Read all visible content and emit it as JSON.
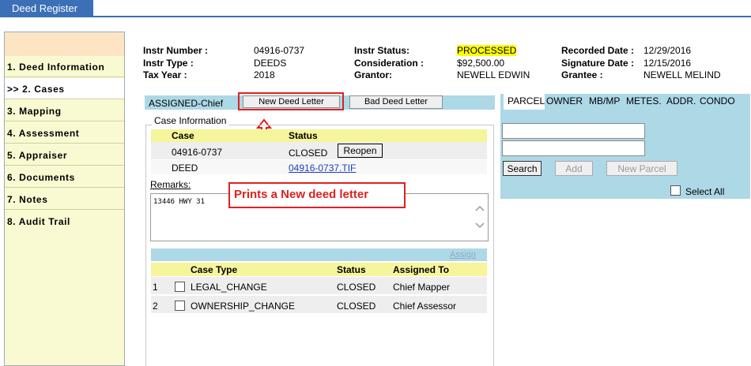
{
  "app": {
    "title": "Deed Register"
  },
  "sidebar": {
    "items": [
      {
        "label": "1. Deed Information"
      },
      {
        "label": ">> 2. Cases"
      },
      {
        "label": "3. Mapping"
      },
      {
        "label": "4. Assessment"
      },
      {
        "label": "5. Appraiser"
      },
      {
        "label": "6. Documents"
      },
      {
        "label": "7. Notes"
      },
      {
        "label": "8. Audit Trail"
      }
    ]
  },
  "header": {
    "instr_number_label": "Instr Number :",
    "instr_number": "04916-0737",
    "instr_type_label": "Instr Type :",
    "instr_type": "DEEDS",
    "tax_year_label": "Tax Year :",
    "tax_year": "2018",
    "instr_status_label": "Instr Status:",
    "instr_status": "PROCESSED",
    "consideration_label": "Consideration :",
    "consideration": "$92,500.00",
    "grantor_label": "Grantor:",
    "grantor": "NEWELL EDWIN",
    "recorded_date_label": "Recorded Date :",
    "recorded_date": "12/29/2016",
    "signature_date_label": "Signature Date :",
    "signature_date": "12/15/2016",
    "grantee_label": "Grantee :",
    "grantee": "NEWELL MELIND"
  },
  "assigned": {
    "label": "ASSIGNED-Chief",
    "new_deed_letter": "New Deed Letter",
    "bad_deed_letter": "Bad Deed Letter"
  },
  "case_info": {
    "legend": "Case Information",
    "headers": {
      "case": "Case",
      "status": "Status"
    },
    "case": "04916-0737",
    "status": "CLOSED",
    "reopen": "Reopen",
    "doc_type": "DEED",
    "doc_link": " 04916-0737.TIF"
  },
  "remarks": {
    "label": "Remarks:",
    "text": "13446 HWY 31"
  },
  "annotation": {
    "text": "Prints a New deed letter"
  },
  "case_types": {
    "assign": "Assign",
    "headers": {
      "case_type": "Case Type",
      "status": "Status",
      "assigned_to": "Assigned To"
    },
    "rows": [
      {
        "num": "1",
        "case_type": "LEGAL_CHANGE",
        "status": "CLOSED",
        "assigned_to": "Chief Mapper"
      },
      {
        "num": "2",
        "case_type": "OWNERSHIP_CHANGE",
        "status": "CLOSED",
        "assigned_to": "Chief Assessor"
      }
    ]
  },
  "right": {
    "tabs": [
      "PARCEL",
      "OWNER",
      "MB/MP",
      "METES.",
      "ADDR.",
      "CONDO"
    ],
    "search": "Search",
    "add": "Add",
    "new_parcel": "New Parcel",
    "select_all": "Select All",
    "input1": "",
    "input2": ""
  },
  "colors": {
    "accent": "#3b6fb6",
    "panel_blue": "#add8e6",
    "sidebar_bg": "#fafad2",
    "highlight": "#ffff00",
    "annotation_red": "#e02020"
  }
}
